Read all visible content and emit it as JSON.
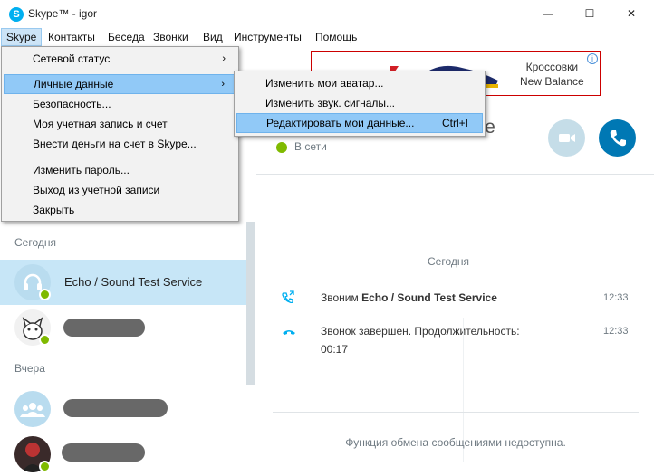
{
  "window": {
    "title": "Skype™ - igor",
    "logo_letter": "S",
    "minimize": "—",
    "maximize": "☐",
    "close": "✕"
  },
  "menubar": [
    "Skype",
    "Контакты",
    "Беседа",
    "Звонки",
    "Вид",
    "Инструменты",
    "Помощь"
  ],
  "skype_menu": {
    "items": [
      {
        "label": "Сетевой статус",
        "submenu": true
      },
      {
        "label": "Личные данные",
        "submenu": true,
        "highlighted": true
      },
      {
        "label": "Безопасность..."
      },
      {
        "label": "Моя учетная запись и счет"
      },
      {
        "label": "Внести деньги на счет в Skype..."
      },
      {
        "label": "Изменить пароль..."
      },
      {
        "label": "Выход из учетной записи"
      },
      {
        "label": "Закрыть"
      }
    ],
    "arrow": "›"
  },
  "personal_submenu": {
    "items": [
      {
        "label": "Изменить мои аватар...",
        "shortcut": ""
      },
      {
        "label": "Изменить звук. сигналы...",
        "shortcut": ""
      },
      {
        "label": "Редактировать мои данные...",
        "shortcut": "Ctrl+I",
        "highlighted": true
      }
    ]
  },
  "sidebar": {
    "today_label": "Сегодня",
    "yesterday_label": "Вчера",
    "conversations": [
      {
        "name": "Echo / Sound Test Service",
        "selected": true,
        "icon": "headset-icon"
      },
      {
        "name": "",
        "blurred": true,
        "icon": "cat-avatar"
      },
      {
        "name": "",
        "blurred": true,
        "icon": "group-icon"
      },
      {
        "name": "",
        "blurred": true,
        "icon": "character-avatar"
      }
    ]
  },
  "ad": {
    "line1": "Кроссовки",
    "line2": "New Balance",
    "info": "i"
  },
  "conversation": {
    "title": "ice",
    "status": "В сети",
    "day_label": "Сегодня",
    "messages": [
      {
        "prefix": "Звоним ",
        "bold": "Echo / Sound Test Service",
        "time": "12:33",
        "icon": "call-out-icon"
      },
      {
        "text": "Звонок завершен. Продолжительность:",
        "duration": "00:17",
        "time": "12:33",
        "icon": "call-end-icon"
      }
    ],
    "footer": "Функция обмена сообщениями недоступна."
  },
  "colors": {
    "accent": "#00aff0",
    "call_button": "#0078b4",
    "video_button": "#c5dde8",
    "online": "#7fba00",
    "menu_highlight": "#91c9f7"
  }
}
